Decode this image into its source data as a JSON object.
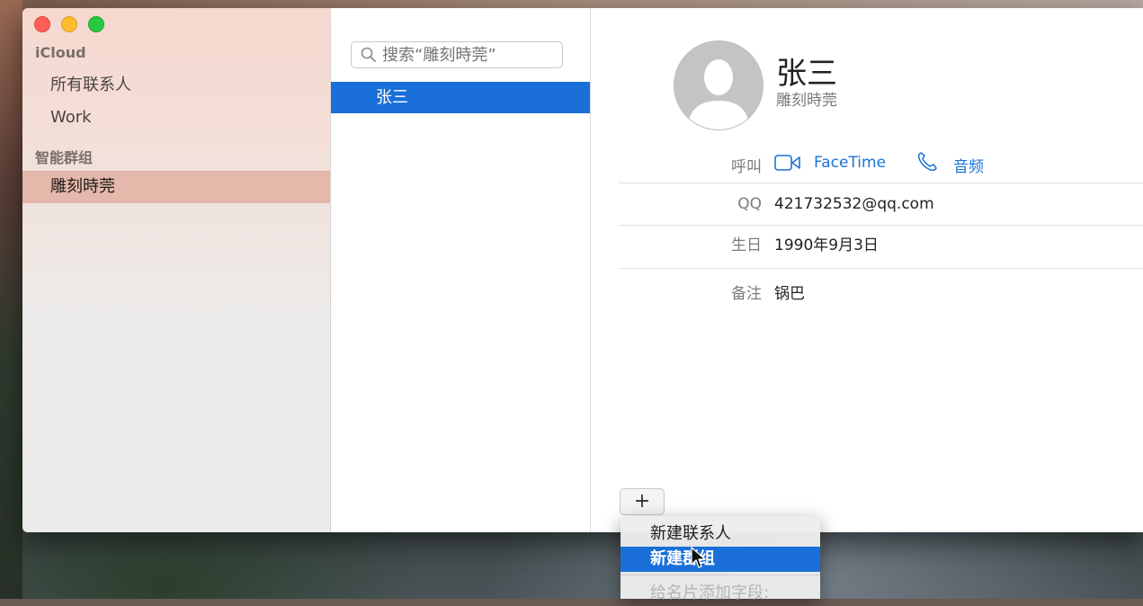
{
  "sidebar": {
    "account": "iCloud",
    "items": [
      {
        "label": "所有联系人"
      },
      {
        "label": "Work"
      }
    ],
    "smart_header": "智能群组",
    "smart_items": [
      {
        "label": "雕刻時莞"
      }
    ]
  },
  "list": {
    "search_placeholder": "搜索“雕刻時莞”",
    "contacts": [
      {
        "name": "张三"
      }
    ]
  },
  "detail": {
    "name": "张三",
    "company": "雕刻時莞",
    "call_label": "呼叫",
    "facetime_label": "FaceTime",
    "audio_label": "音频",
    "fields": [
      {
        "label": "QQ",
        "value": "421732532@qq.com"
      },
      {
        "label": "生日",
        "value": "1990年9月3日"
      },
      {
        "label": "备注",
        "value": "锅巴"
      }
    ],
    "add_button": "+"
  },
  "menu": {
    "items": [
      "新建联系人",
      "新建群组",
      "给名片添加字段:"
    ],
    "highlighted_index": 1
  },
  "colors": {
    "accent": "#1a6fd8",
    "link": "#1a73d6"
  }
}
